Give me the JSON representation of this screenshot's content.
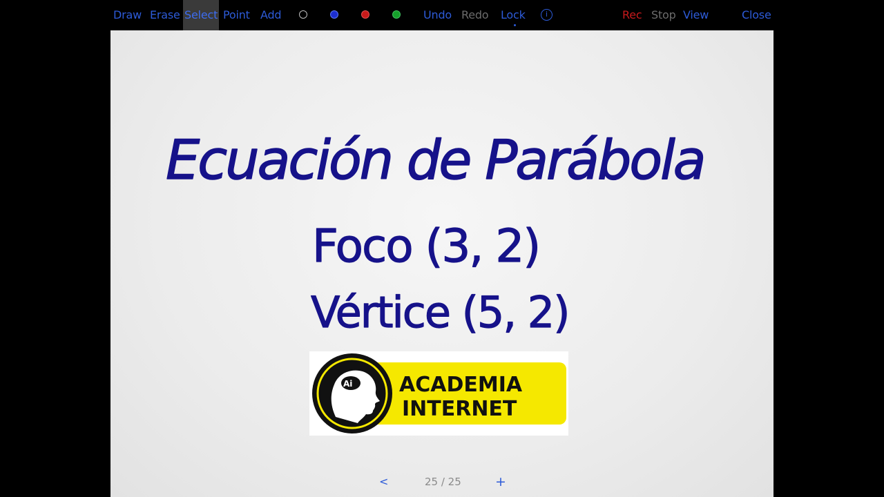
{
  "toolbar": {
    "draw": "Draw",
    "erase": "Erase",
    "select": "Select",
    "point": "Point",
    "add": "Add",
    "colors": [
      "#ffffff",
      "#1d2fd0",
      "#c81a1a",
      "#16a02b"
    ],
    "color_icons": [
      "color-white-icon",
      "color-blue-icon",
      "color-red-icon",
      "color-green-icon"
    ],
    "undo": "Undo",
    "redo": "Redo",
    "lock": "Lock",
    "info": "i",
    "rec": "Rec",
    "stop": "Stop",
    "view": "View",
    "close": "Close"
  },
  "whiteboard": {
    "title": "Ecuación de Parábola",
    "focus": "Foco (3, 2)",
    "vertex": "Vértice (5, 2)",
    "ink_color": "#16128a"
  },
  "logo": {
    "line1": "ACADEMIA",
    "line2": "INTERNET",
    "badge": "Ai",
    "accent": "#f5e800"
  },
  "pager": {
    "prev": "<",
    "page": "25 / 25",
    "add": "+"
  }
}
